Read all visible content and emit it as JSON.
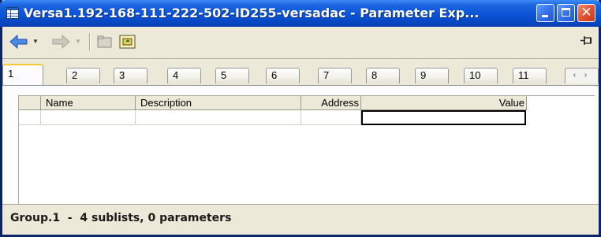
{
  "window": {
    "title": "Versa1.192-168-111-222-502-ID255-versadac - Parameter Exp..."
  },
  "tabs": [
    {
      "label": "1",
      "active": true
    },
    {
      "label": "2"
    },
    {
      "label": "3"
    },
    {
      "label": "4"
    },
    {
      "label": "5"
    },
    {
      "label": "6"
    },
    {
      "label": "7"
    },
    {
      "label": "8"
    },
    {
      "label": "9"
    },
    {
      "label": "10"
    },
    {
      "label": "11"
    }
  ],
  "table": {
    "columns": [
      "Name",
      "Description",
      "Address",
      "Value"
    ]
  },
  "status": {
    "text": "Group.1  -  4 sublists, 0 parameters"
  },
  "colors": {
    "titlebar": "#0A53D8",
    "face": "#ECE9D8",
    "close_button": "#E0502F",
    "active_tab_accent": "#FFC83C"
  }
}
